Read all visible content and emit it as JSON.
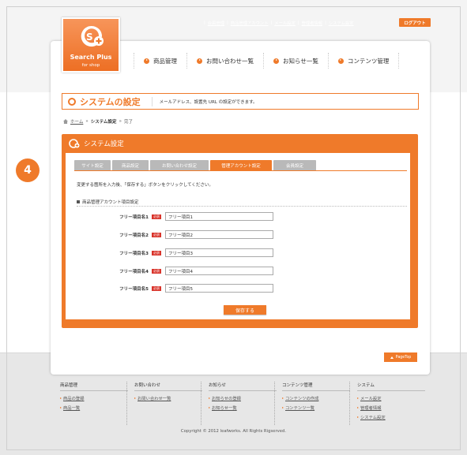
{
  "toplinks": [
    "会員管理",
    "商品管理アカウント",
    "メール設定",
    "管理者情報",
    "システム設定"
  ],
  "logout_label": "ログアウト",
  "logo": {
    "line1": "Search Plus",
    "line2": "for shop"
  },
  "gnav": [
    "商品管理",
    "お問い合わせ一覧",
    "お知らせ一覧",
    "コンテンツ管理"
  ],
  "page_title": "システムの設定",
  "page_desc": "メールアドレス、設置先 URL の設定ができます。",
  "breadcrumb": {
    "home": "ホーム",
    "sep": "»",
    "parent": "システム設定",
    "current": "完了"
  },
  "step_number": "4",
  "settings": {
    "title": "システム設定",
    "tabs": [
      "サイト設定",
      "商品設定",
      "お問い合わせ設定",
      "管理アカウント設定",
      "会員設定"
    ],
    "active_tab_index": 3,
    "instruction": "変更する箇所を入力後、「保存する」ボタンをクリックしてください。",
    "section_title": "商品管理アカウント項目設定",
    "required_label": "必須",
    "fields": [
      {
        "label": "フリー項目名1",
        "value": "フリー項目1"
      },
      {
        "label": "フリー項目名2",
        "value": "フリー項目2"
      },
      {
        "label": "フリー項目名3",
        "value": "フリー項目3"
      },
      {
        "label": "フリー項目名4",
        "value": "フリー項目4"
      },
      {
        "label": "フリー項目名5",
        "value": "フリー項目5"
      }
    ],
    "save_label": "保存する"
  },
  "pagetop_label": "PageTop",
  "footer": {
    "cols": [
      {
        "head": "商品管理",
        "links": [
          "商品の登録",
          "商品一覧"
        ]
      },
      {
        "head": "お問い合わせ",
        "links": [
          "お問い合わせ一覧"
        ]
      },
      {
        "head": "お知らせ",
        "links": [
          "お知らせの登録",
          "お知らせ一覧"
        ]
      },
      {
        "head": "コンテンツ管理",
        "links": [
          "コンテンツの作成",
          "コンテンツ一覧"
        ]
      },
      {
        "head": "システム",
        "links": [
          "メール設定",
          "管理者情報",
          "システム設定"
        ]
      }
    ],
    "copyright": "Copyright © 2012 leafworks. All Rights Rigserved."
  },
  "colors": {
    "accent": "#ef7a2a",
    "required": "#d9342b",
    "tab_inactive": "#b9b9b9"
  }
}
